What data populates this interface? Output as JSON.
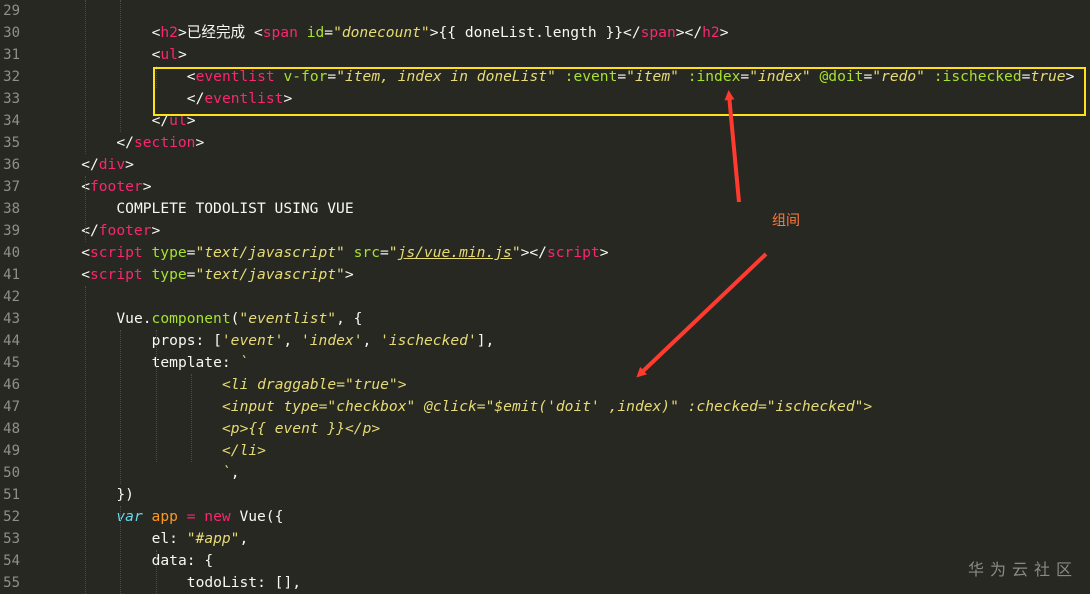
{
  "editor": {
    "lines": [
      {
        "num": "29",
        "tokens": []
      },
      {
        "num": "30",
        "tokens": [
          {
            "t": "<",
            "c": "t-punct"
          },
          {
            "t": "h2",
            "c": "t-tag"
          },
          {
            "t": ">",
            "c": "t-punct"
          },
          {
            "t": "已经完成 ",
            "c": "t-text"
          },
          {
            "t": "<",
            "c": "t-punct"
          },
          {
            "t": "span",
            "c": "t-tag"
          },
          {
            "t": " ",
            "c": "t-text"
          },
          {
            "t": "id",
            "c": "t-attr"
          },
          {
            "t": "=",
            "c": "t-punct"
          },
          {
            "t": "\"donecount\"",
            "c": "t-str"
          },
          {
            "t": ">",
            "c": "t-punct"
          },
          {
            "t": "{{ doneList.length }}",
            "c": "t-text"
          },
          {
            "t": "</",
            "c": "t-punct"
          },
          {
            "t": "span",
            "c": "t-tag"
          },
          {
            "t": "></",
            "c": "t-punct"
          },
          {
            "t": "h2",
            "c": "t-tag"
          },
          {
            "t": ">",
            "c": "t-punct"
          }
        ]
      },
      {
        "num": "31",
        "tokens": [
          {
            "t": "<",
            "c": "t-punct"
          },
          {
            "t": "ul",
            "c": "t-tag"
          },
          {
            "t": ">",
            "c": "t-punct"
          }
        ]
      },
      {
        "num": "32",
        "tokens": [
          {
            "t": "<",
            "c": "t-punct"
          },
          {
            "t": "eventlist",
            "c": "t-tag"
          },
          {
            "t": " ",
            "c": "t-text"
          },
          {
            "t": "v-for",
            "c": "t-attr"
          },
          {
            "t": "=",
            "c": "t-punct"
          },
          {
            "t": "\"item, index in doneList\"",
            "c": "t-str"
          },
          {
            "t": " ",
            "c": "t-text"
          },
          {
            "t": ":event",
            "c": "t-attr"
          },
          {
            "t": "=",
            "c": "t-punct"
          },
          {
            "t": "\"item\"",
            "c": "t-str"
          },
          {
            "t": " ",
            "c": "t-text"
          },
          {
            "t": ":index",
            "c": "t-attr"
          },
          {
            "t": "=",
            "c": "t-punct"
          },
          {
            "t": "\"index\"",
            "c": "t-str"
          },
          {
            "t": " ",
            "c": "t-text"
          },
          {
            "t": "@doit",
            "c": "t-attr"
          },
          {
            "t": "=",
            "c": "t-punct"
          },
          {
            "t": "\"redo\"",
            "c": "t-str"
          },
          {
            "t": " ",
            "c": "t-text"
          },
          {
            "t": ":ischecked",
            "c": "t-attr"
          },
          {
            "t": "=",
            "c": "t-punct"
          },
          {
            "t": "true",
            "c": "t-str"
          },
          {
            "t": ">",
            "c": "t-punct"
          }
        ]
      },
      {
        "num": "33",
        "tokens": [
          {
            "t": "</",
            "c": "t-punct"
          },
          {
            "t": "eventlist",
            "c": "t-tag"
          },
          {
            "t": ">",
            "c": "t-punct"
          }
        ]
      },
      {
        "num": "34",
        "tokens": [
          {
            "t": "</",
            "c": "t-punct"
          },
          {
            "t": "ul",
            "c": "t-tag"
          },
          {
            "t": ">",
            "c": "t-punct"
          }
        ]
      },
      {
        "num": "35",
        "tokens": [
          {
            "t": "</",
            "c": "t-punct"
          },
          {
            "t": "section",
            "c": "t-tag"
          },
          {
            "t": ">",
            "c": "t-punct"
          }
        ]
      },
      {
        "num": "36",
        "tokens": [
          {
            "t": "</",
            "c": "t-punct"
          },
          {
            "t": "div",
            "c": "t-tag"
          },
          {
            "t": ">",
            "c": "t-punct"
          }
        ]
      },
      {
        "num": "37",
        "tokens": [
          {
            "t": "<",
            "c": "t-punct"
          },
          {
            "t": "footer",
            "c": "t-tag"
          },
          {
            "t": ">",
            "c": "t-punct"
          }
        ]
      },
      {
        "num": "38",
        "tokens": [
          {
            "t": "COMPLETE TODOLIST USING VUE",
            "c": "t-text"
          }
        ]
      },
      {
        "num": "39",
        "tokens": [
          {
            "t": "</",
            "c": "t-punct"
          },
          {
            "t": "footer",
            "c": "t-tag"
          },
          {
            "t": ">",
            "c": "t-punct"
          }
        ]
      },
      {
        "num": "40",
        "tokens": [
          {
            "t": "<",
            "c": "t-punct"
          },
          {
            "t": "script",
            "c": "t-tag"
          },
          {
            "t": " ",
            "c": "t-text"
          },
          {
            "t": "type",
            "c": "t-attr"
          },
          {
            "t": "=",
            "c": "t-punct"
          },
          {
            "t": "\"text/javascript\"",
            "c": "t-str"
          },
          {
            "t": " ",
            "c": "t-text"
          },
          {
            "t": "src",
            "c": "t-attr"
          },
          {
            "t": "=",
            "c": "t-punct"
          },
          {
            "t": "\"",
            "c": "t-str"
          },
          {
            "t": "js/vue.min.js",
            "c": "t-str t-under"
          },
          {
            "t": "\"",
            "c": "t-str"
          },
          {
            "t": "></",
            "c": "t-punct"
          },
          {
            "t": "script",
            "c": "t-tag"
          },
          {
            "t": ">",
            "c": "t-punct"
          }
        ]
      },
      {
        "num": "41",
        "tokens": [
          {
            "t": "<",
            "c": "t-punct"
          },
          {
            "t": "script",
            "c": "t-tag"
          },
          {
            "t": " ",
            "c": "t-text"
          },
          {
            "t": "type",
            "c": "t-attr"
          },
          {
            "t": "=",
            "c": "t-punct"
          },
          {
            "t": "\"text/javascript\"",
            "c": "t-str"
          },
          {
            "t": ">",
            "c": "t-punct"
          }
        ]
      },
      {
        "num": "42",
        "tokens": []
      },
      {
        "num": "43",
        "tokens": [
          {
            "t": "Vue",
            "c": "t-plain"
          },
          {
            "t": ".",
            "c": "t-plain"
          },
          {
            "t": "component",
            "c": "t-attr"
          },
          {
            "t": "(",
            "c": "t-plain"
          },
          {
            "t": "\"eventlist\"",
            "c": "t-str"
          },
          {
            "t": ", {",
            "c": "t-plain"
          }
        ]
      },
      {
        "num": "44",
        "tokens": [
          {
            "t": "props",
            "c": "t-prop"
          },
          {
            "t": ": [",
            "c": "t-plain"
          },
          {
            "t": "'event'",
            "c": "t-str"
          },
          {
            "t": ", ",
            "c": "t-plain"
          },
          {
            "t": "'index'",
            "c": "t-str"
          },
          {
            "t": ", ",
            "c": "t-plain"
          },
          {
            "t": "'ischecked'",
            "c": "t-str"
          },
          {
            "t": "],",
            "c": "t-plain"
          }
        ]
      },
      {
        "num": "45",
        "tokens": [
          {
            "t": "template",
            "c": "t-prop"
          },
          {
            "t": ": ",
            "c": "t-plain"
          },
          {
            "t": "`",
            "c": "t-tpl"
          }
        ]
      },
      {
        "num": "46",
        "tokens": [
          {
            "t": "<li draggable=\"true\">",
            "c": "t-tpl"
          }
        ]
      },
      {
        "num": "47",
        "tokens": [
          {
            "t": "<input type=\"checkbox\" @click=\"$emit('doit' ,index)\" :checked=\"ischecked\">",
            "c": "t-tpl"
          }
        ]
      },
      {
        "num": "48",
        "tokens": [
          {
            "t": "<p>{{ event }}</p>",
            "c": "t-tpl"
          }
        ]
      },
      {
        "num": "49",
        "tokens": [
          {
            "t": "</li>",
            "c": "t-tpl"
          }
        ]
      },
      {
        "num": "50",
        "tokens": [
          {
            "t": "`",
            "c": "t-tpl"
          },
          {
            "t": ",",
            "c": "t-plain"
          }
        ]
      },
      {
        "num": "51",
        "tokens": [
          {
            "t": "})",
            "c": "t-plain"
          }
        ]
      },
      {
        "num": "52",
        "tokens": [
          {
            "t": "var",
            "c": "t-kw"
          },
          {
            "t": " ",
            "c": "t-plain"
          },
          {
            "t": "app",
            "c": "t-var"
          },
          {
            "t": " ",
            "c": "t-plain"
          },
          {
            "t": "=",
            "c": "t-op"
          },
          {
            "t": " ",
            "c": "t-plain"
          },
          {
            "t": "new",
            "c": "t-op"
          },
          {
            "t": " Vue({",
            "c": "t-plain"
          }
        ]
      },
      {
        "num": "53",
        "tokens": [
          {
            "t": "el",
            "c": "t-prop"
          },
          {
            "t": ": ",
            "c": "t-plain"
          },
          {
            "t": "\"#app\"",
            "c": "t-str"
          },
          {
            "t": ",",
            "c": "t-plain"
          }
        ]
      },
      {
        "num": "54",
        "tokens": [
          {
            "t": "data",
            "c": "t-prop"
          },
          {
            "t": ": {",
            "c": "t-plain"
          }
        ]
      },
      {
        "num": "55",
        "tokens": [
          {
            "t": "todoList",
            "c": "t-prop"
          },
          {
            "t": ": [],",
            "c": "t-plain"
          }
        ]
      }
    ]
  },
  "annotation": {
    "label": "组间"
  },
  "watermark": {
    "text": "华为云社区"
  },
  "colors": {
    "background": "#272822",
    "highlight_box": "#ffe019",
    "arrow": "#ff3b30",
    "annotation_text": "#ff7a3c"
  }
}
